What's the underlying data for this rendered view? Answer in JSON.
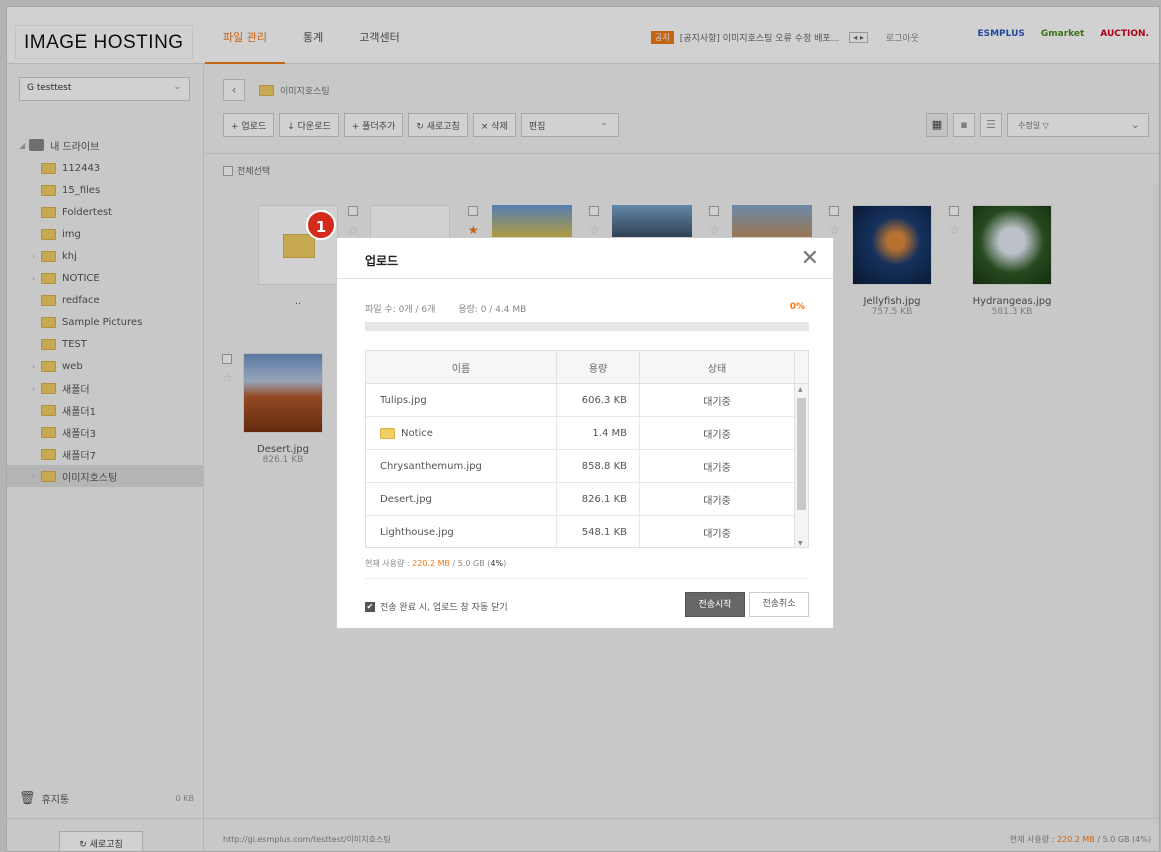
{
  "header": {
    "logo": "IMAGE HOSTING",
    "nav": [
      "파일 관리",
      "통계",
      "고객센터"
    ],
    "notice_tag": "공지",
    "notice_text": "[공지사항] 이미지호스팅 오류 수정 배포...",
    "notice_arrows": "◂ ▸",
    "logout": "로그아웃",
    "brands": [
      "ESMPLUS",
      "Gmarket",
      "AUCTION."
    ]
  },
  "sidebar": {
    "account": "G testtest",
    "root": "내 드라이브",
    "folders": [
      {
        "name": "112443",
        "toggle": ""
      },
      {
        "name": "15_files",
        "toggle": ""
      },
      {
        "name": "Foldertest",
        "toggle": ""
      },
      {
        "name": "img",
        "toggle": ""
      },
      {
        "name": "khj",
        "toggle": "›"
      },
      {
        "name": "NOTICE",
        "toggle": "›"
      },
      {
        "name": "redface",
        "toggle": ""
      },
      {
        "name": "Sample Pictures",
        "toggle": ""
      },
      {
        "name": "TEST",
        "toggle": ""
      },
      {
        "name": "web",
        "toggle": "›"
      },
      {
        "name": "새폴더",
        "toggle": "›"
      },
      {
        "name": "새폴더1",
        "toggle": ""
      },
      {
        "name": "새폴더3",
        "toggle": ""
      },
      {
        "name": "새폴더7",
        "toggle": ""
      },
      {
        "name": "이미지호스팅",
        "toggle": "›"
      }
    ],
    "trash": "휴지통",
    "trash_size": "0 KB",
    "refresh": "새로고침"
  },
  "main": {
    "current_folder": "이미지호스팅",
    "toolbar": [
      "+ 업로드",
      "↓ 다운로드",
      "+ 폴더추가",
      "새로고침",
      "× 삭제"
    ],
    "edit_select": "편집",
    "sort_select": "수정일 ▽",
    "select_all": "전체선택",
    "up_label": "..",
    "files": [
      {
        "name": "Jellyfish.jpg",
        "size": "757.5 KB"
      },
      {
        "name": "Hydrangeas.jpg",
        "size": "581.3 KB"
      },
      {
        "name": "Desert.jpg",
        "size": "826.1 KB"
      }
    ],
    "status_url": "http://gi.esmplus.com/testtest/이미지호스팅",
    "status_used_label": "현재 사용량 :",
    "status_used_value": "220.2 MB",
    "status_used_total": "/ 5.0 GB (4%)"
  },
  "dialog": {
    "badge": "1",
    "title": "업로드",
    "file_count": "파일 수: 0개 / 6개",
    "capacity": "용량: 0 / 4.4 MB",
    "percent": "0%",
    "progress": 0,
    "columns": [
      "이름",
      "용량",
      "상태"
    ],
    "rows": [
      {
        "name": "Tulips.jpg",
        "size": "606.3 KB",
        "status": "대기중",
        "folder": false
      },
      {
        "name": "Notice",
        "size": "1.4 MB",
        "status": "대기중",
        "folder": true
      },
      {
        "name": "Chrysanthemum.jpg",
        "size": "858.8 KB",
        "status": "대기중",
        "folder": false
      },
      {
        "name": "Desert.jpg",
        "size": "826.1 KB",
        "status": "대기중",
        "folder": false
      },
      {
        "name": "Lighthouse.jpg",
        "size": "548.1 KB",
        "status": "대기중",
        "folder": false
      }
    ],
    "usage_label": "현재 사용량 :",
    "usage_value": "220.2 MB",
    "usage_total": "/ 5.0 GB (",
    "usage_pct": "4%",
    "usage_close": ")",
    "auto_close": "전송 완료 시, 업로드 창 자동 닫기",
    "start": "전송시작",
    "cancel": "전송취소"
  },
  "colors": {
    "accent": "#f07a1a",
    "badge": "#d42a1b"
  }
}
